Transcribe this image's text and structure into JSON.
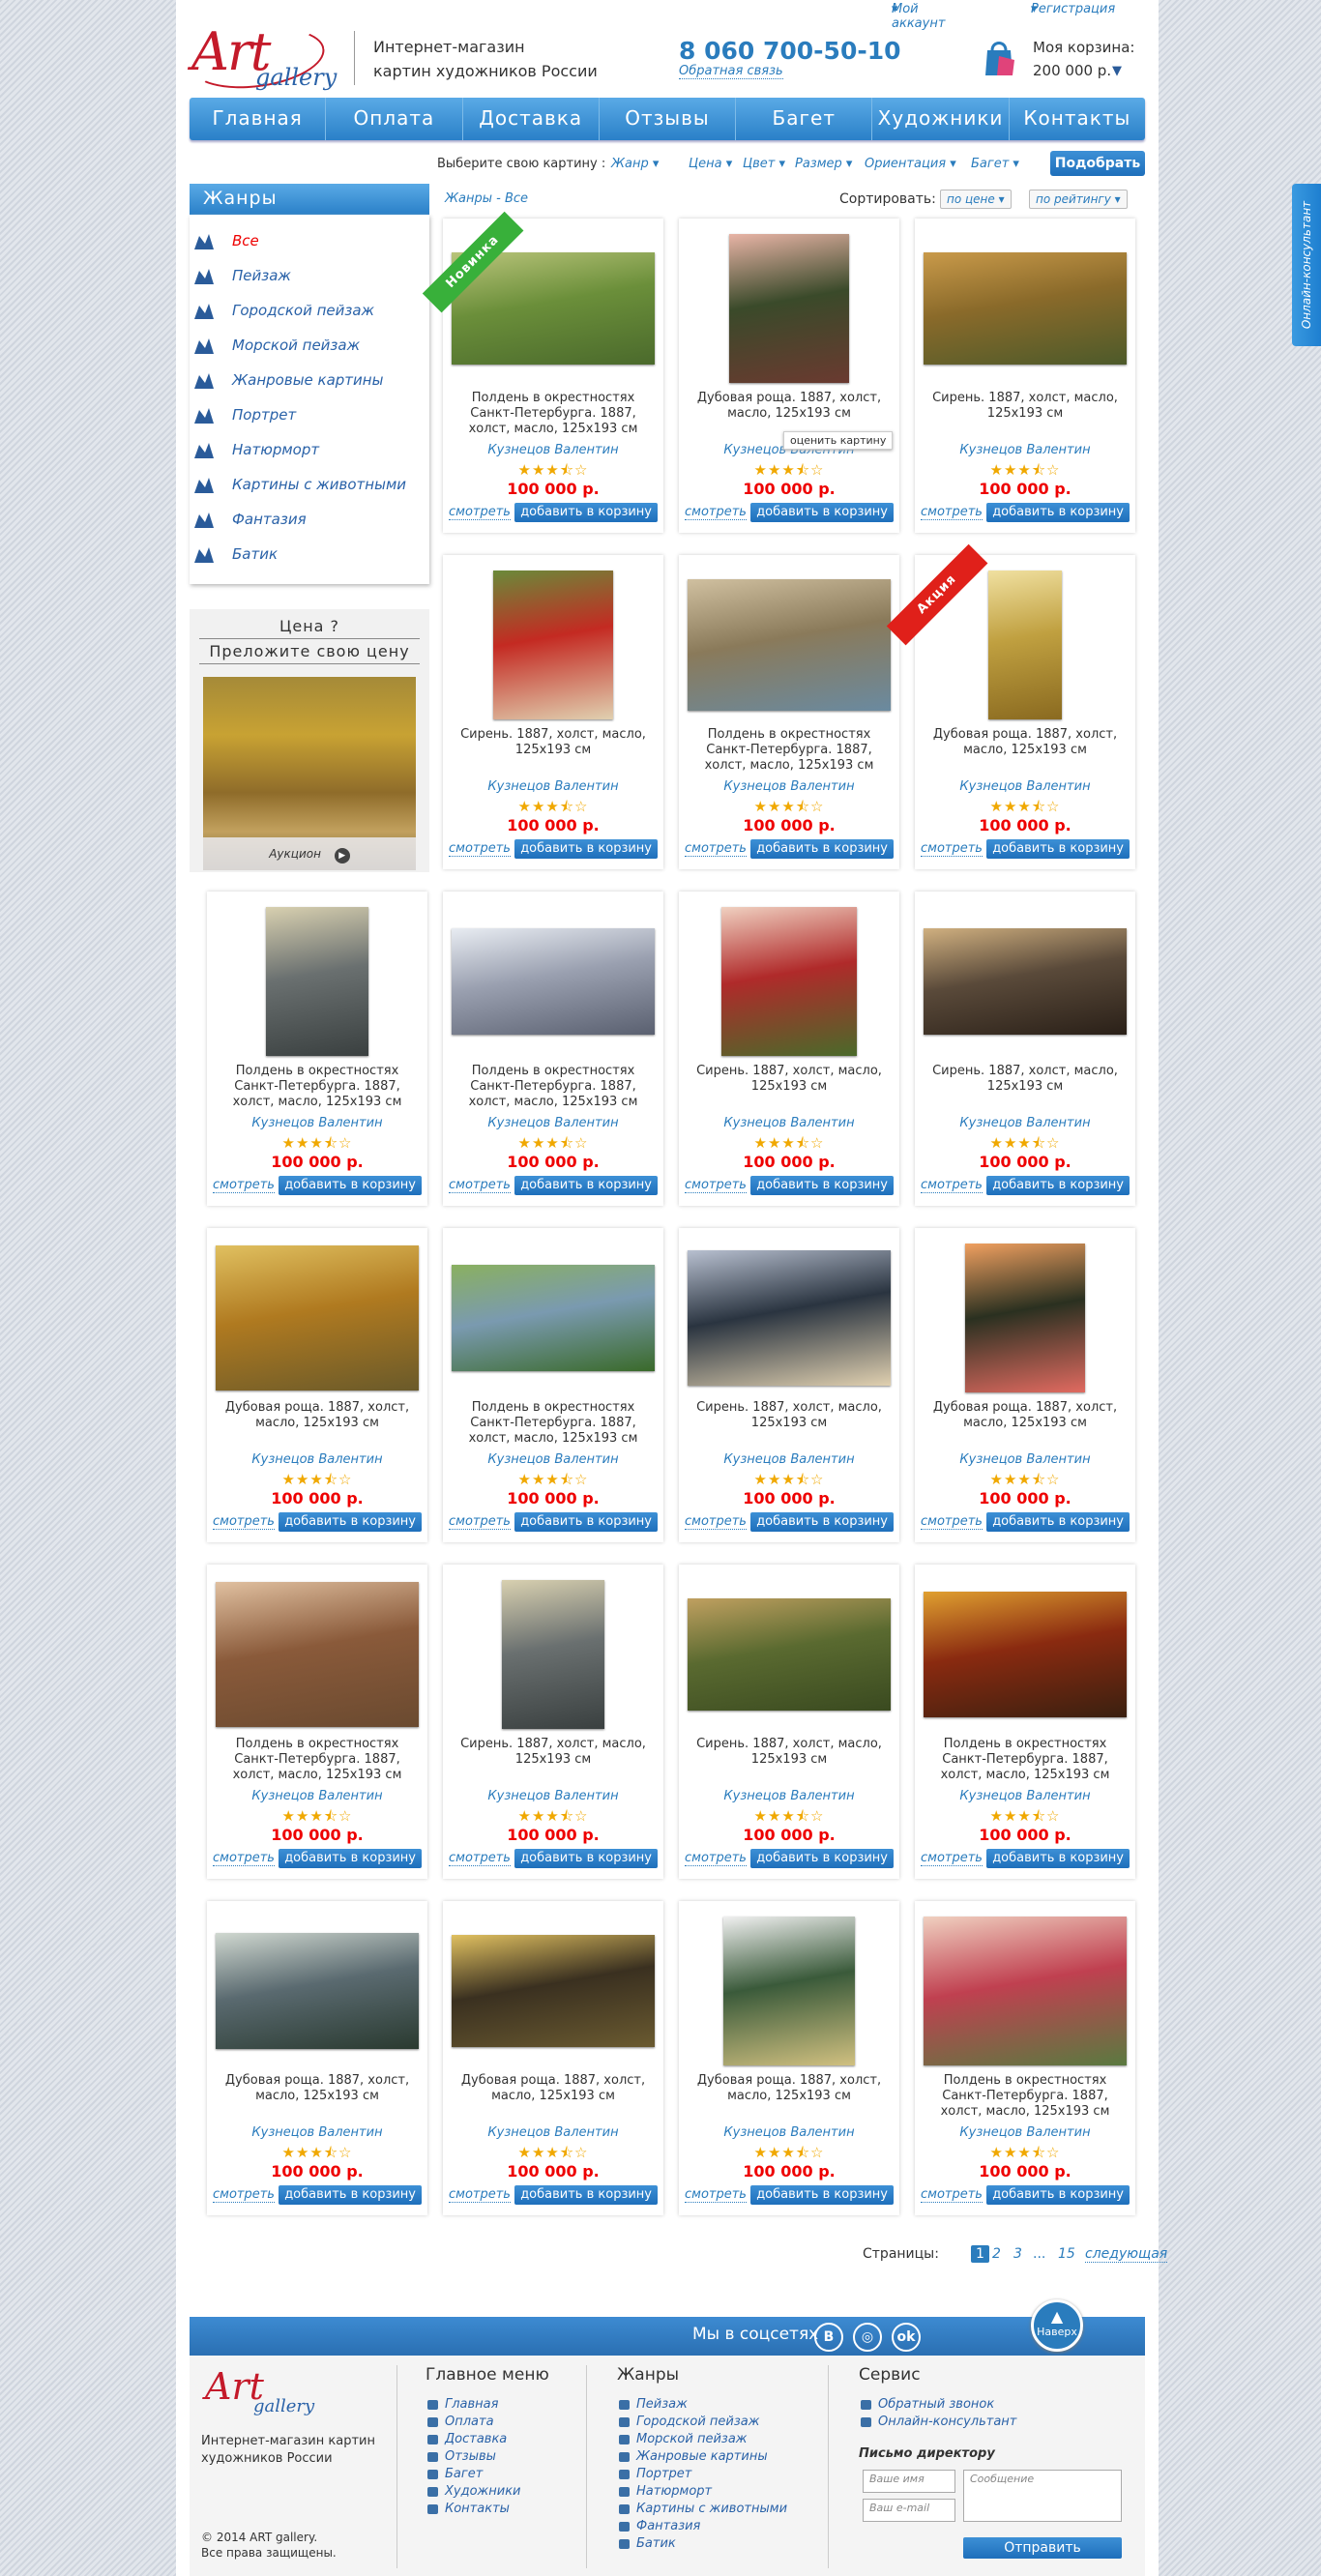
{
  "toplinks": {
    "account": "Мой аккаунт",
    "register": "Регистрация"
  },
  "header": {
    "tagline_line1": "Интернет-магазин",
    "tagline_line2": "картин художников России",
    "phone": "8 060 700-50-10",
    "callback": "Обратная связь",
    "cart_title": "Моя корзина:",
    "cart_sum": "200 000 р."
  },
  "logo": {
    "art": "Art",
    "gallery": "gallery"
  },
  "nav": [
    "Главная",
    "Оплата",
    "Доставка",
    "Отзывы",
    "Багет",
    "Художники",
    "Контакты"
  ],
  "filters": {
    "label": "Выберите свою картину :",
    "items": [
      "Жанр",
      "Цена",
      "Цвет",
      "Размер",
      "Ориентация",
      "Багет"
    ],
    "button": "Подобрать"
  },
  "sidebar": {
    "title": "Жанры",
    "genres": [
      "Все",
      "Пейзаж",
      "Городской пейзаж",
      "Морской пейзаж",
      "Жанровые картины",
      "Портрет",
      "Натюрморт",
      "Картины с животными",
      "Фантазия",
      "Батик"
    ],
    "price_title": "Цена ?",
    "price_sub": "Преложите свою цену",
    "auction": "Аукцион"
  },
  "content": {
    "breadcrumb": "Жанры - Все",
    "sort_label": "Сортировать:",
    "sort_price": "по цене",
    "sort_rating": "по рейтингу",
    "view_label": "смотреть",
    "add_label": "добавить в корзину",
    "tooltip": "оценить картину",
    "ribbon_new": "Новинка",
    "ribbon_sale": "Акция"
  },
  "products": [
    {
      "title": "Полдень в окрестностях Санкт-Петербурга. 1887, холст, масло, 125х193 см",
      "author": "Кузнецов Валентин",
      "price": "100 000 р.",
      "rating": 3.5,
      "ribbon": "new"
    },
    {
      "title": "Дубовая роща. 1887, холст, масло, 125х193 см",
      "author": "Кузнецов Валентин",
      "price": "100 000 р.",
      "rating": 3.5,
      "tooltip": true
    },
    {
      "title": "Сирень. 1887, холст, масло, 125х193 см",
      "author": "Кузнецов Валентин",
      "price": "100 000 р.",
      "rating": 3.5
    },
    {
      "title": "Сирень. 1887, холст, масло, 125х193 см",
      "author": "Кузнецов Валентин",
      "price": "100 000 р.",
      "rating": 3.5
    },
    {
      "title": "Полдень в окрестностях Санкт-Петербурга. 1887, холст, масло, 125х193 см",
      "author": "Кузнецов Валентин",
      "price": "100 000 р.",
      "rating": 3.5
    },
    {
      "title": "Дубовая роща. 1887, холст, масло, 125х193 см",
      "author": "Кузнецов Валентин",
      "price": "100 000 р.",
      "rating": 3.5,
      "ribbon": "sale"
    },
    {
      "title": "Полдень в окрестностях Санкт-Петербурга. 1887, холст, масло, 125х193 см",
      "author": "Кузнецов Валентин",
      "price": "100 000 р.",
      "rating": 3.5
    },
    {
      "title": "Полдень в окрестностях Санкт-Петербурга. 1887, холст, масло, 125х193 см",
      "author": "Кузнецов Валентин",
      "price": "100 000 р.",
      "rating": 3.5
    },
    {
      "title": "Сирень. 1887, холст, масло, 125х193 см",
      "author": "Кузнецов Валентин",
      "price": "100 000 р.",
      "rating": 3.5
    },
    {
      "title": "Сирень. 1887, холст, масло, 125х193 см",
      "author": "Кузнецов Валентин",
      "price": "100 000 р.",
      "rating": 3.5
    },
    {
      "title": "Дубовая роща. 1887, холст, масло, 125х193 см",
      "author": "Кузнецов Валентин",
      "price": "100 000 р.",
      "rating": 3.5
    },
    {
      "title": "Полдень в окрестностях Санкт-Петербурга. 1887, холст, масло, 125х193 см",
      "author": "Кузнецов Валентин",
      "price": "100 000 р.",
      "rating": 3.5
    },
    {
      "title": "Сирень. 1887, холст, масло, 125х193 см",
      "author": "Кузнецов Валентин",
      "price": "100 000 р.",
      "rating": 3.5
    },
    {
      "title": "Дубовая роща. 1887, холст, масло, 125х193 см",
      "author": "Кузнецов Валентин",
      "price": "100 000 р.",
      "rating": 3.5
    },
    {
      "title": "Полдень в окрестностях Санкт-Петербурга. 1887, холст, масло, 125х193 см",
      "author": "Кузнецов Валентин",
      "price": "100 000 р.",
      "rating": 3.5
    },
    {
      "title": "Сирень. 1887, холст, масло, 125х193 см",
      "author": "Кузнецов Валентин",
      "price": "100 000 р.",
      "rating": 3.5
    },
    {
      "title": "Сирень. 1887, холст, масло, 125х193 см",
      "author": "Кузнецов Валентин",
      "price": "100 000 р.",
      "rating": 3.5
    },
    {
      "title": "Полдень в окрестностях Санкт-Петербурга. 1887, холст, масло, 125х193 см",
      "author": "Кузнецов Валентин",
      "price": "100 000 р.",
      "rating": 3.5
    },
    {
      "title": "Дубовая роща. 1887, холст, масло, 125х193 см",
      "author": "Кузнецов Валентин",
      "price": "100 000 р.",
      "rating": 3.5
    },
    {
      "title": "Дубовая роща. 1887, холст, масло, 125х193 см",
      "author": "Кузнецов Валентин",
      "price": "100 000 р.",
      "rating": 3.5
    },
    {
      "title": "Дубовая роща. 1887, холст, масло, 125х193 см",
      "author": "Кузнецов Валентин",
      "price": "100 000 р.",
      "rating": 3.5
    },
    {
      "title": "Полдень в окрестностях Санкт-Петербурга. 1887, холст, масло, 125х193 см",
      "author": "Кузнецов Валентин",
      "price": "100 000 р.",
      "rating": 3.5
    }
  ],
  "pagination": {
    "label": "Страницы:",
    "pages": [
      "1",
      "2",
      "3",
      "...",
      "15"
    ],
    "next": "следующая"
  },
  "social": {
    "title": "Мы в соцсетях",
    "up": "Наверх"
  },
  "footer": {
    "tagline": "Интернет-магазин картин художников России",
    "copyright": "© 2014 ART gallery.",
    "rights": "Все права защищены.",
    "menu_title": "Главное меню",
    "menu": [
      "Главная",
      "Оплата",
      "Доставка",
      "Отзывы",
      "Багет",
      "Художники",
      "Контакты"
    ],
    "genres_title": "Жанры",
    "genres": [
      "Пейзаж",
      "Городской пейзаж",
      "Морской пейзаж",
      "Жанровые картины",
      "Портрет",
      "Натюрморт",
      "Картины с животными",
      "Фантазия",
      "Батик"
    ],
    "service_title": "Сервис",
    "service": [
      "Обратный звонок",
      "Онлайн-консультант"
    ],
    "letter_title": "Письмо директору",
    "name_ph": "Ваше имя",
    "email_ph": "Ваш e-mail",
    "msg_ph": "Сообщение",
    "send": "Отправить"
  },
  "consultant": "Онлайн-консультант",
  "colors": {
    "accent": "#2a7cbd",
    "price": "#e00000",
    "logo_red": "#c41a2a",
    "ribbon_new": "#38b03a",
    "ribbon_sale": "#e0201a"
  }
}
